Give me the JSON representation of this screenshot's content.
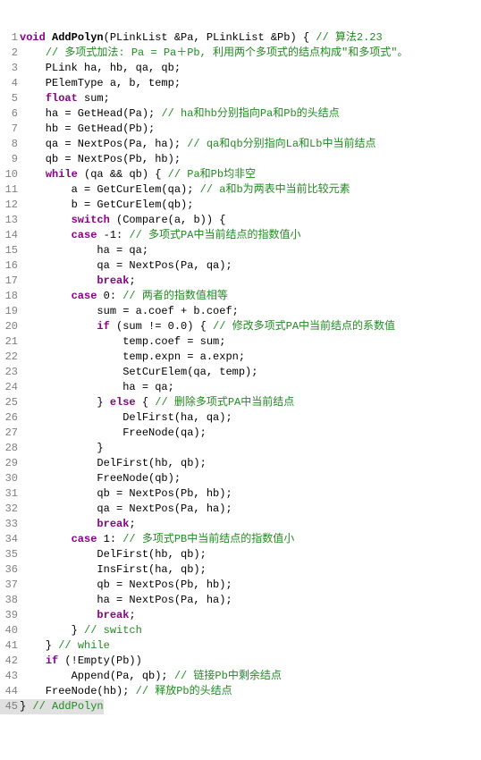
{
  "lines": [
    {
      "n": "1",
      "segs": [
        {
          "t": "void",
          "c": "kw"
        },
        {
          "t": " "
        },
        {
          "t": "AddPolyn",
          "c": "fn"
        },
        {
          "t": "(PLinkList &Pa, PLinkList &Pb) { "
        },
        {
          "t": "// 算法2.23",
          "c": "cm"
        }
      ]
    },
    {
      "n": "2",
      "segs": [
        {
          "t": "    "
        },
        {
          "t": "// 多项式加法: Pa = Pa＋Pb, 利用两个多项式的结点构成\"和多项式\"。",
          "c": "cm"
        }
      ]
    },
    {
      "n": "3",
      "segs": [
        {
          "t": "    PLink ha, hb, qa, qb;"
        }
      ]
    },
    {
      "n": "4",
      "segs": [
        {
          "t": "    PElemType a, b, temp;"
        }
      ]
    },
    {
      "n": "5",
      "segs": [
        {
          "t": "    "
        },
        {
          "t": "float",
          "c": "kw"
        },
        {
          "t": " sum;"
        }
      ]
    },
    {
      "n": "6",
      "segs": [
        {
          "t": "    ha = GetHead(Pa); "
        },
        {
          "t": "// ha和hb分别指向Pa和Pb的头结点",
          "c": "cm"
        }
      ]
    },
    {
      "n": "7",
      "segs": [
        {
          "t": "    hb = GetHead(Pb);"
        }
      ]
    },
    {
      "n": "8",
      "segs": [
        {
          "t": "    qa = NextPos(Pa, ha); "
        },
        {
          "t": "// qa和qb分别指向La和Lb中当前结点",
          "c": "cm"
        }
      ]
    },
    {
      "n": "9",
      "segs": [
        {
          "t": "    qb = NextPos(Pb, hb);"
        }
      ]
    },
    {
      "n": "10",
      "segs": [
        {
          "t": "    "
        },
        {
          "t": "while",
          "c": "kw"
        },
        {
          "t": " (qa && qb) { "
        },
        {
          "t": "// Pa和Pb均非空",
          "c": "cm"
        }
      ]
    },
    {
      "n": "11",
      "segs": [
        {
          "t": "        a = GetCurElem(qa); "
        },
        {
          "t": "// a和b为两表中当前比较元素",
          "c": "cm"
        }
      ]
    },
    {
      "n": "12",
      "segs": [
        {
          "t": "        b = GetCurElem(qb);"
        }
      ]
    },
    {
      "n": "13",
      "segs": [
        {
          "t": "        "
        },
        {
          "t": "switch",
          "c": "kw"
        },
        {
          "t": " (Compare(a, b)) {"
        }
      ]
    },
    {
      "n": "14",
      "segs": [
        {
          "t": "        "
        },
        {
          "t": "case",
          "c": "kw"
        },
        {
          "t": " -1: "
        },
        {
          "t": "// 多项式PA中当前结点的指数值小",
          "c": "cm"
        }
      ]
    },
    {
      "n": "15",
      "segs": [
        {
          "t": "            ha = qa;"
        }
      ]
    },
    {
      "n": "16",
      "segs": [
        {
          "t": "            qa = NextPos(Pa, qa);"
        }
      ]
    },
    {
      "n": "17",
      "segs": [
        {
          "t": "            "
        },
        {
          "t": "break",
          "c": "kw"
        },
        {
          "t": ";"
        }
      ]
    },
    {
      "n": "18",
      "segs": [
        {
          "t": "        "
        },
        {
          "t": "case",
          "c": "kw"
        },
        {
          "t": " 0: "
        },
        {
          "t": "// 两者的指数值相等",
          "c": "cm"
        }
      ]
    },
    {
      "n": "19",
      "segs": [
        {
          "t": "            sum = a.coef + b.coef;"
        }
      ]
    },
    {
      "n": "20",
      "segs": [
        {
          "t": "            "
        },
        {
          "t": "if",
          "c": "kw"
        },
        {
          "t": " (sum != 0.0) { "
        },
        {
          "t": "// 修改多项式PA中当前结点的系数值",
          "c": "cm"
        }
      ]
    },
    {
      "n": "21",
      "segs": [
        {
          "t": "                temp.coef = sum;"
        }
      ]
    },
    {
      "n": "22",
      "segs": [
        {
          "t": "                temp.expn = a.expn;"
        }
      ]
    },
    {
      "n": "23",
      "segs": [
        {
          "t": "                SetCurElem(qa, temp);"
        }
      ]
    },
    {
      "n": "24",
      "segs": [
        {
          "t": "                ha = qa;"
        }
      ]
    },
    {
      "n": "25",
      "segs": [
        {
          "t": "            } "
        },
        {
          "t": "else",
          "c": "kw"
        },
        {
          "t": " { "
        },
        {
          "t": "// 删除多项式PA中当前结点",
          "c": "cm"
        }
      ]
    },
    {
      "n": "26",
      "segs": [
        {
          "t": "                DelFirst(ha, qa);"
        }
      ]
    },
    {
      "n": "27",
      "segs": [
        {
          "t": "                FreeNode(qa);"
        }
      ]
    },
    {
      "n": "28",
      "segs": [
        {
          "t": "            }"
        }
      ]
    },
    {
      "n": "29",
      "segs": [
        {
          "t": "            DelFirst(hb, qb);"
        }
      ]
    },
    {
      "n": "30",
      "segs": [
        {
          "t": "            FreeNode(qb);"
        }
      ]
    },
    {
      "n": "31",
      "segs": [
        {
          "t": "            qb = NextPos(Pb, hb);"
        }
      ]
    },
    {
      "n": "32",
      "segs": [
        {
          "t": "            qa = NextPos(Pa, ha);"
        }
      ]
    },
    {
      "n": "33",
      "segs": [
        {
          "t": "            "
        },
        {
          "t": "break",
          "c": "kw"
        },
        {
          "t": ";"
        }
      ]
    },
    {
      "n": "34",
      "segs": [
        {
          "t": "        "
        },
        {
          "t": "case",
          "c": "kw"
        },
        {
          "t": " 1: "
        },
        {
          "t": "// 多项式PB中当前结点的指数值小",
          "c": "cm"
        }
      ]
    },
    {
      "n": "35",
      "segs": [
        {
          "t": "            DelFirst(hb, qb);"
        }
      ]
    },
    {
      "n": "36",
      "segs": [
        {
          "t": "            InsFirst(ha, qb);"
        }
      ]
    },
    {
      "n": "37",
      "segs": [
        {
          "t": "            qb = NextPos(Pb, hb);"
        }
      ]
    },
    {
      "n": "38",
      "segs": [
        {
          "t": "            ha = NextPos(Pa, ha);"
        }
      ]
    },
    {
      "n": "39",
      "segs": [
        {
          "t": "            "
        },
        {
          "t": "break",
          "c": "kw"
        },
        {
          "t": ";"
        }
      ]
    },
    {
      "n": "40",
      "segs": [
        {
          "t": "        } "
        },
        {
          "t": "// switch",
          "c": "cm"
        }
      ]
    },
    {
      "n": "41",
      "segs": [
        {
          "t": "    } "
        },
        {
          "t": "// while",
          "c": "cm"
        }
      ]
    },
    {
      "n": "42",
      "segs": [
        {
          "t": "    "
        },
        {
          "t": "if",
          "c": "kw"
        },
        {
          "t": " (!Empty(Pb))"
        }
      ]
    },
    {
      "n": "43",
      "segs": [
        {
          "t": "        Append(Pa, qb); "
        },
        {
          "t": "// 链接Pb中剩余结点",
          "c": "cm"
        }
      ]
    },
    {
      "n": "44",
      "segs": [
        {
          "t": "    FreeNode(hb); "
        },
        {
          "t": "// 释放Pb的头结点",
          "c": "cm"
        }
      ]
    },
    {
      "n": "45",
      "segs": [
        {
          "t": "} "
        },
        {
          "t": "// AddPolyn",
          "c": "cm"
        }
      ],
      "hl": true
    }
  ]
}
